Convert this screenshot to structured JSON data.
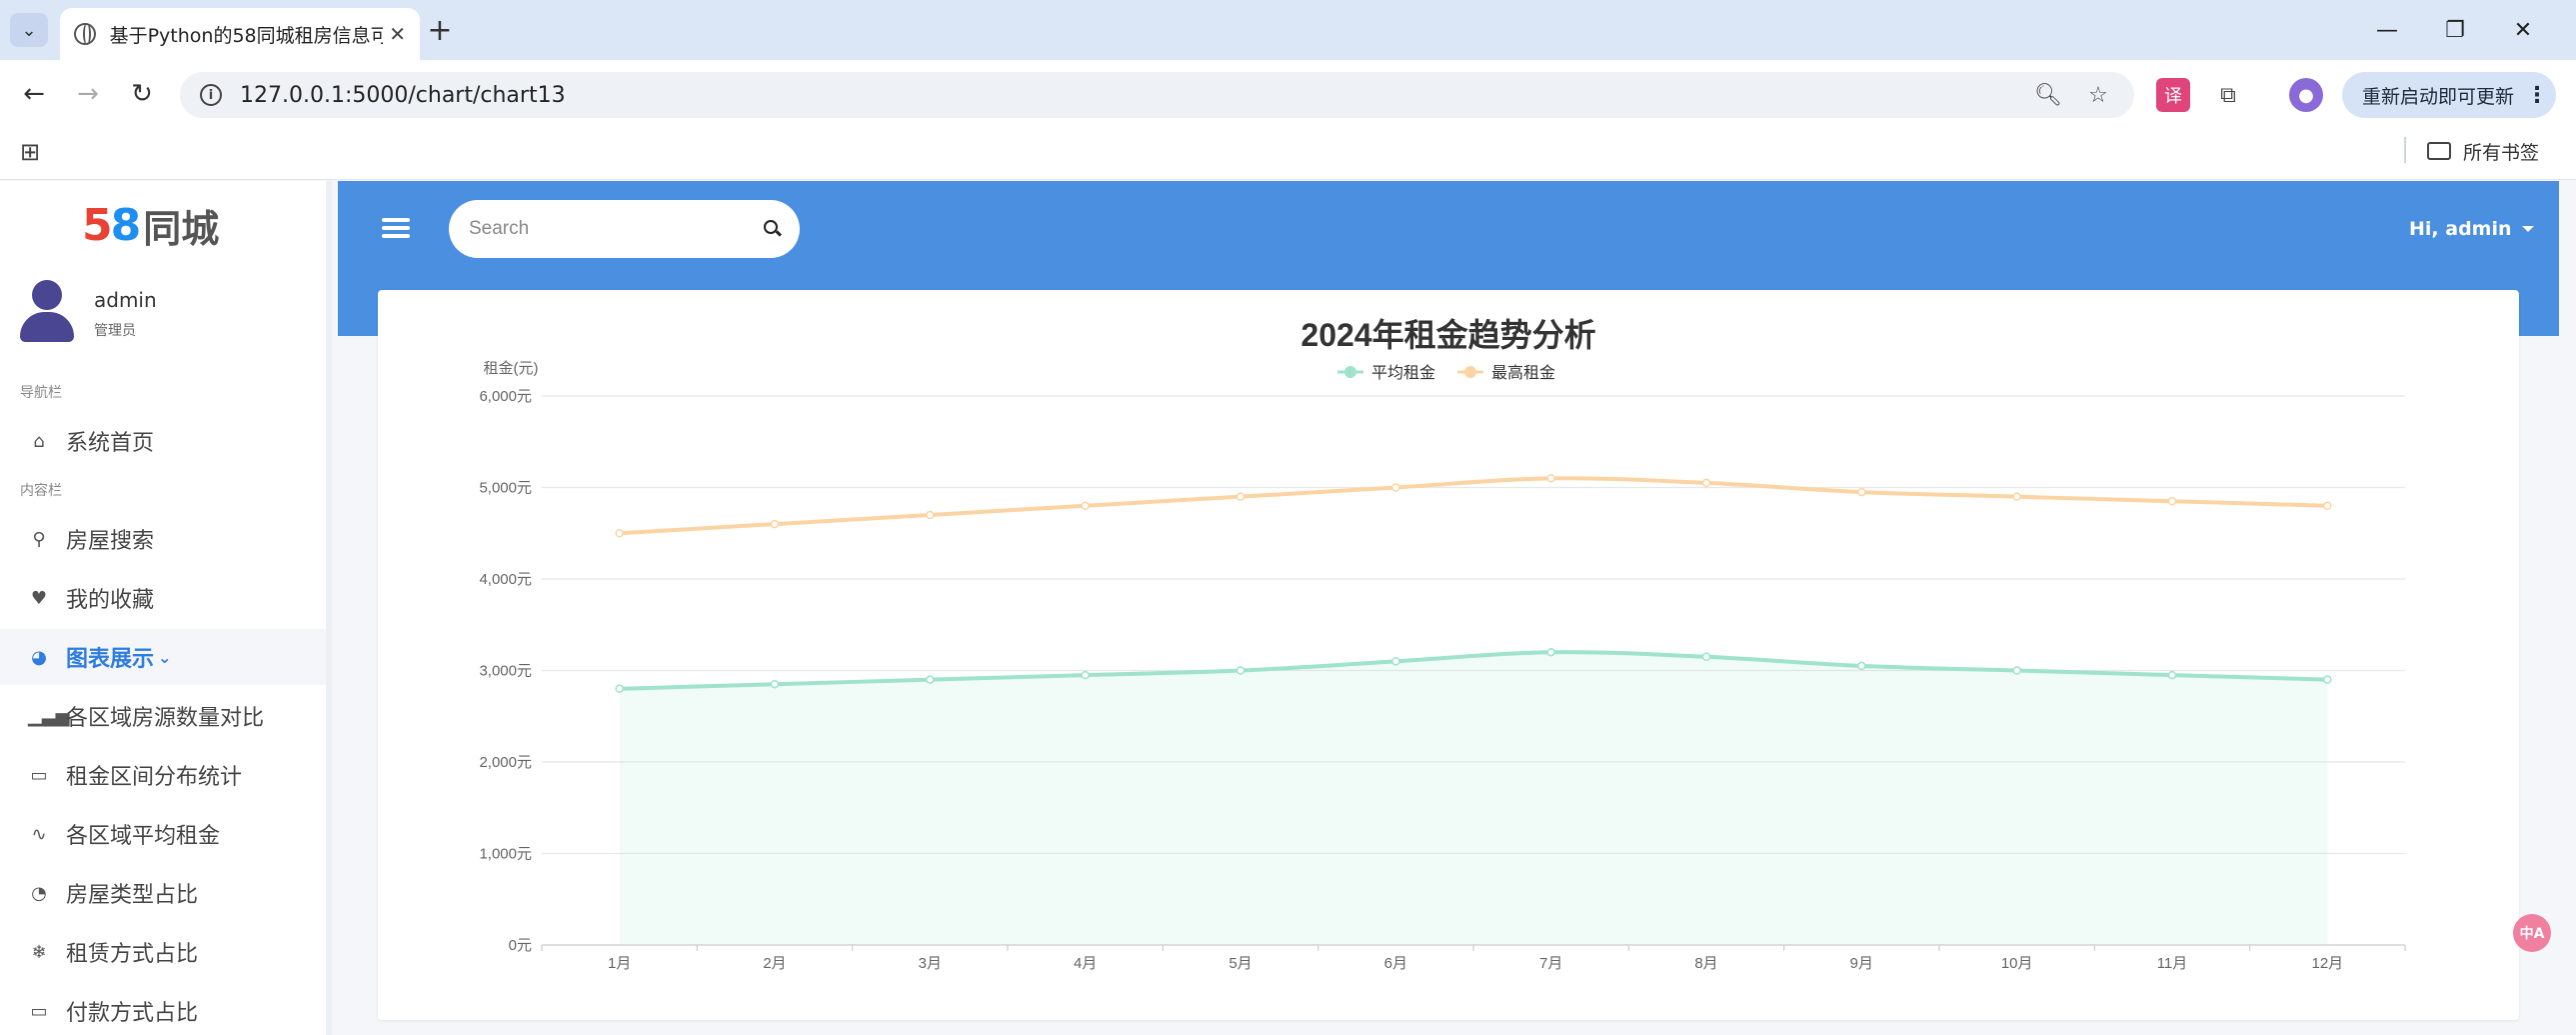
{
  "browser": {
    "tab_title": "基于Python的58同城租房信息可视化",
    "url": "127.0.0.1:5000/chart/chart13",
    "update_label": "重新启动即可更新",
    "bookmarks_label": "所有书签"
  },
  "sidebar": {
    "logo_five": "5",
    "logo_eight": "8",
    "logo_text": "同城",
    "user_name": "admin",
    "user_role": "管理员",
    "nav_section": "导航栏",
    "content_section": "内容栏",
    "items": [
      {
        "label": "系统首页"
      },
      {
        "label": "房屋搜索"
      },
      {
        "label": "我的收藏"
      },
      {
        "label": "图表展示"
      },
      {
        "label": "各区域房源数量对比"
      },
      {
        "label": "租金区间分布统计"
      },
      {
        "label": "各区域平均租金"
      },
      {
        "label": "房屋类型占比"
      },
      {
        "label": "租赁方式占比"
      },
      {
        "label": "付款方式占比"
      }
    ]
  },
  "header": {
    "search_placeholder": "Search",
    "greeting": "Hi, admin"
  },
  "floating": {
    "label": "中A"
  },
  "colors": {
    "topbar": "#4a8fe0",
    "avg_series": "#9fe3cc",
    "max_series": "#fcd4a4",
    "active_menu": "#2f7de1"
  },
  "chart_data": {
    "type": "line",
    "title": "2024年租金趋势分析",
    "ylabel": "租金(元)",
    "xlabel": "",
    "categories": [
      "1月",
      "2月",
      "3月",
      "4月",
      "5月",
      "6月",
      "7月",
      "8月",
      "9月",
      "10月",
      "11月",
      "12月"
    ],
    "ylim": [
      0,
      6000
    ],
    "yticks": [
      "0元",
      "1,000元",
      "2,000元",
      "3,000元",
      "4,000元",
      "5,000元",
      "6,000元"
    ],
    "legend_position": "top-center",
    "grid": true,
    "series": [
      {
        "name": "平均租金",
        "values": [
          2800,
          2850,
          2900,
          2950,
          3000,
          3100,
          3200,
          3150,
          3050,
          3000,
          2950,
          2900
        ],
        "color": "#9fe3cc",
        "area": true
      },
      {
        "name": "最高租金",
        "values": [
          4500,
          4600,
          4700,
          4800,
          4900,
          5000,
          5100,
          5050,
          4950,
          4900,
          4850,
          4800
        ],
        "color": "#fcd4a4",
        "area": false
      }
    ]
  }
}
